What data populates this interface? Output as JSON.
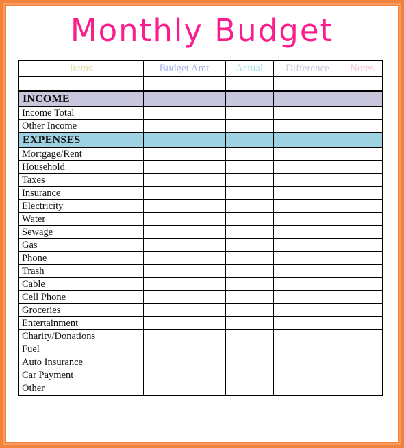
{
  "document": {
    "title": "Monthly Budget",
    "title_color": "#fa1e8c",
    "border_color": "#f2813c"
  },
  "table": {
    "columns": [
      {
        "key": "items",
        "label": "Items",
        "color": "#dede9a"
      },
      {
        "key": "budget",
        "label": "Budget Amt",
        "color": "#aab4e8"
      },
      {
        "key": "actual",
        "label": "Actual",
        "color": "#a8dfe0"
      },
      {
        "key": "diff",
        "label": "Difference",
        "color": "#c9c9dd"
      },
      {
        "key": "notes",
        "label": "Notes",
        "color": "#f3c2d2"
      }
    ],
    "sections": [
      {
        "name": "INCOME",
        "banner_color": "#c7c6dd",
        "rows": [
          {
            "label": "Income Total",
            "budget": "",
            "actual": "",
            "diff": "",
            "notes": ""
          },
          {
            "label": "Other Income",
            "budget": "",
            "actual": "",
            "diff": "",
            "notes": ""
          }
        ]
      },
      {
        "name": "EXPENSES",
        "banner_color": "#9ed2e3",
        "rows": [
          {
            "label": "Mortgage/Rent",
            "budget": "",
            "actual": "",
            "diff": "",
            "notes": ""
          },
          {
            "label": "Household",
            "budget": "",
            "actual": "",
            "diff": "",
            "notes": ""
          },
          {
            "label": "Taxes",
            "budget": "",
            "actual": "",
            "diff": "",
            "notes": ""
          },
          {
            "label": "Insurance",
            "budget": "",
            "actual": "",
            "diff": "",
            "notes": ""
          },
          {
            "label": "Electricity",
            "budget": "",
            "actual": "",
            "diff": "",
            "notes": ""
          },
          {
            "label": "Water",
            "budget": "",
            "actual": "",
            "diff": "",
            "notes": ""
          },
          {
            "label": "Sewage",
            "budget": "",
            "actual": "",
            "diff": "",
            "notes": ""
          },
          {
            "label": "Gas",
            "budget": "",
            "actual": "",
            "diff": "",
            "notes": ""
          },
          {
            "label": "Phone",
            "budget": "",
            "actual": "",
            "diff": "",
            "notes": ""
          },
          {
            "label": "Trash",
            "budget": "",
            "actual": "",
            "diff": "",
            "notes": ""
          },
          {
            "label": "Cable",
            "budget": "",
            "actual": "",
            "diff": "",
            "notes": ""
          },
          {
            "label": "Cell Phone",
            "budget": "",
            "actual": "",
            "diff": "",
            "notes": ""
          },
          {
            "label": "Groceries",
            "budget": "",
            "actual": "",
            "diff": "",
            "notes": ""
          },
          {
            "label": "Entertainment",
            "budget": "",
            "actual": "",
            "diff": "",
            "notes": ""
          },
          {
            "label": "Charity/Donations",
            "budget": "",
            "actual": "",
            "diff": "",
            "notes": ""
          },
          {
            "label": "Fuel",
            "budget": "",
            "actual": "",
            "diff": "",
            "notes": ""
          },
          {
            "label": "Auto Insurance",
            "budget": "",
            "actual": "",
            "diff": "",
            "notes": ""
          },
          {
            "label": "Car Payment",
            "budget": "",
            "actual": "",
            "diff": "",
            "notes": ""
          },
          {
            "label": "Other",
            "budget": "",
            "actual": "",
            "diff": "",
            "notes": ""
          }
        ]
      }
    ]
  }
}
